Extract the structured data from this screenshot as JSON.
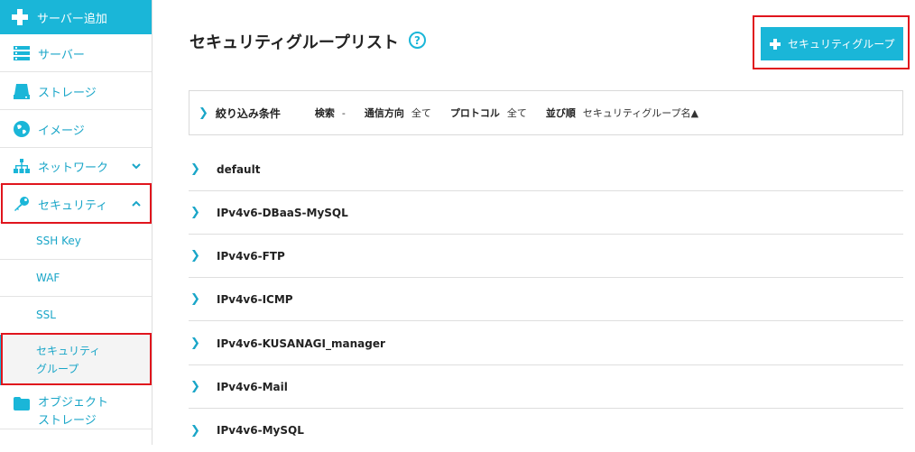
{
  "sidebar": {
    "add_server": "サーバー追加",
    "items": [
      {
        "label": "サーバー"
      },
      {
        "label": "ストレージ"
      },
      {
        "label": "イメージ"
      },
      {
        "label": "ネットワーク"
      },
      {
        "label": "セキュリティ"
      }
    ],
    "sub_items": [
      {
        "label": "SSH Key"
      },
      {
        "label": "WAF"
      },
      {
        "label": "SSL"
      }
    ],
    "active_sub": {
      "line1": "セキュリティ",
      "line2": "グループ"
    },
    "object_storage": {
      "line1": "オブジェクト",
      "line2": "ストレージ"
    }
  },
  "main": {
    "title": "セキュリティグループリスト",
    "help": "?",
    "create_button": "セキュリティグループ",
    "filter": {
      "title": "絞り込み条件",
      "search_label": "検索",
      "search_value": "-",
      "direction_label": "通信方向",
      "direction_value": "全て",
      "protocol_label": "プロトコル",
      "protocol_value": "全て",
      "sort_label": "並び順",
      "sort_value": "セキュリティグループ名▲"
    },
    "groups": [
      {
        "name": "default"
      },
      {
        "name": "IPv4v6-DBaaS-MySQL"
      },
      {
        "name": "IPv4v6-FTP"
      },
      {
        "name": "IPv4v6-ICMP"
      },
      {
        "name": "IPv4v6-KUSANAGI_manager"
      },
      {
        "name": "IPv4v6-Mail"
      },
      {
        "name": "IPv4v6-MySQL"
      }
    ]
  },
  "colors": {
    "accent": "#1ab6d8",
    "highlight": "#e0151d"
  }
}
